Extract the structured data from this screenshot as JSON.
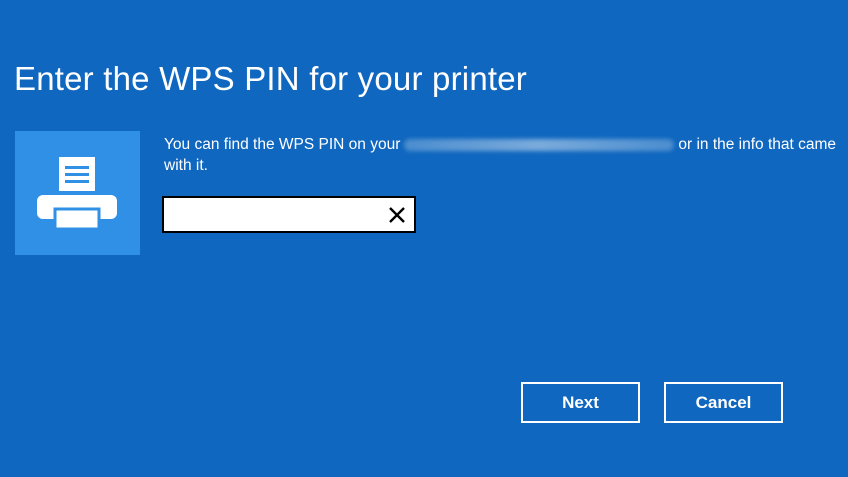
{
  "dialog": {
    "title": "Enter the WPS PIN for your printer",
    "description_before": "You can find the WPS PIN on your",
    "description_after": "or in the info that came with it.",
    "pin_value": ""
  },
  "buttons": {
    "next": "Next",
    "cancel": "Cancel"
  },
  "icons": {
    "printer": "printer-icon",
    "clear": "close-icon"
  },
  "colors": {
    "background": "#0f67bf",
    "tile": "#2f90e6"
  }
}
